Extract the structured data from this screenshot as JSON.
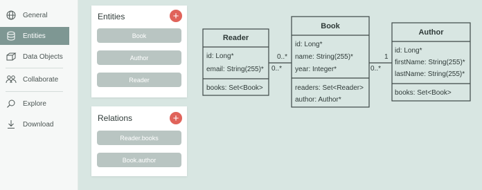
{
  "sidebar": {
    "items": [
      {
        "label": "General",
        "icon": "globe-icon"
      },
      {
        "label": "Entities",
        "icon": "database-icon",
        "active": true
      },
      {
        "label": "Data Objects",
        "icon": "cube-icon"
      },
      {
        "label": "Collaborate",
        "icon": "people-icon"
      },
      {
        "label": "Explore",
        "icon": "search-icon"
      },
      {
        "label": "Download",
        "icon": "download-icon"
      }
    ]
  },
  "entities_panel": {
    "title": "Entities",
    "items": [
      "Book",
      "Author",
      "Reader"
    ]
  },
  "relations_panel": {
    "title": "Relations",
    "items": [
      "Reader.books",
      "Book.author"
    ]
  },
  "colors": {
    "accent": "#e0635a",
    "active_nav": "#7e9793",
    "chip": "#b9c5c2",
    "canvas": "#d8e6e2"
  },
  "diagram": {
    "classes": [
      {
        "name": "Reader",
        "attributes": [
          "id: Long*",
          "email: String(255)*"
        ],
        "relations": [
          "books: Set<Book>"
        ]
      },
      {
        "name": "Book",
        "attributes": [
          "id: Long*",
          "name: String(255)*",
          "year: Integer*"
        ],
        "relations": [
          "readers: Set<Reader>",
          "author: Author*"
        ]
      },
      {
        "name": "Author",
        "attributes": [
          "id: Long*",
          "firstName: String(255)*",
          "lastName: String(255)*"
        ],
        "relations": [
          "books: Set<Book>"
        ]
      }
    ],
    "multiplicities": {
      "reader_book_top": "0..*",
      "reader_book_bottom": "0..*",
      "book_author_top": "1",
      "book_author_bottom": "0..*"
    }
  }
}
